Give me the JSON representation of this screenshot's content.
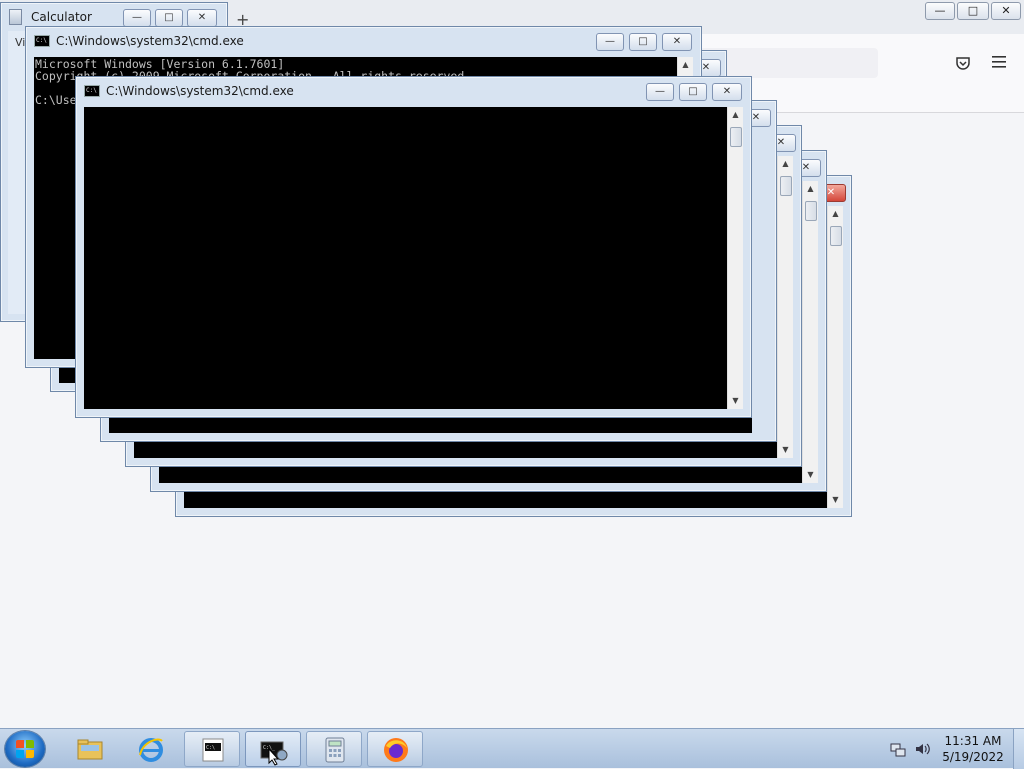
{
  "firefox": {
    "new_tab_symbol": "+",
    "pocket_icon": "pocket-icon",
    "menu_icon": "hamburger-menu-icon"
  },
  "calculator": {
    "title": "Calculator",
    "menu_partial": "Vi"
  },
  "cmd_windows": [
    {
      "title": "C:\\Windows\\system32\\cmd.exe",
      "lines": "Microsoft Windows [Version 6.1.7601]\nCopyright (c) 2009 Microsoft Corporation.  All rights reserved.\n\nC:\\Users\\"
    },
    {
      "title": "C:\\Windows\\system32\\cmd.exe",
      "lines": ""
    }
  ],
  "caption_buttons": {
    "minimize": "—",
    "maximize": "□",
    "close": "✕"
  },
  "taskbar": {
    "items": [
      {
        "name": "windows-explorer",
        "icon": "folder-icon",
        "state": "pinned"
      },
      {
        "name": "internet-explorer",
        "icon": "ie-icon",
        "state": "pinned"
      },
      {
        "name": "cmd-pinned",
        "icon": "cmd-icon",
        "state": "open"
      },
      {
        "name": "cmd-running",
        "icon": "cmd-icon",
        "state": "active"
      },
      {
        "name": "calculator",
        "icon": "calculator-icon",
        "state": "open"
      },
      {
        "name": "firefox",
        "icon": "firefox-icon",
        "state": "open"
      }
    ],
    "time": "11:31 AM",
    "date": "5/19/2022"
  },
  "colors": {
    "taskbar": "#b8cde6",
    "console": "#000000",
    "desktop": "#f4f5f8"
  }
}
